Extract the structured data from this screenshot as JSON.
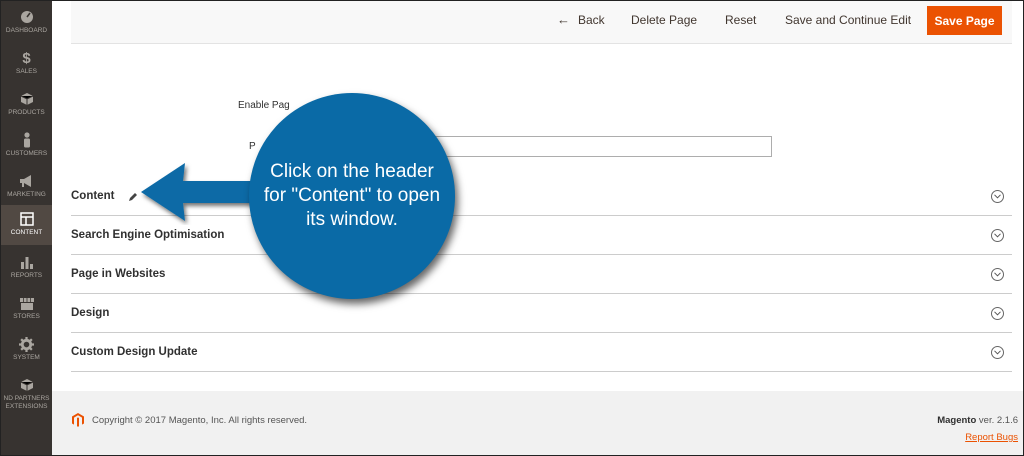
{
  "sidebar": {
    "items": [
      {
        "label": "Dashboard",
        "icon": "dashboard-icon"
      },
      {
        "label": "Sales",
        "icon": "dollar-icon"
      },
      {
        "label": "Products",
        "icon": "box-icon"
      },
      {
        "label": "Customers",
        "icon": "person-icon"
      },
      {
        "label": "Marketing",
        "icon": "megaphone-icon"
      },
      {
        "label": "Content",
        "icon": "layout-icon",
        "active": true
      },
      {
        "label": "Reports",
        "icon": "bar-chart-icon"
      },
      {
        "label": "Stores",
        "icon": "storefront-icon"
      },
      {
        "label": "System",
        "icon": "gear-icon"
      },
      {
        "label_line1": "nd Partners",
        "label_line2": "Extensions",
        "icon": "cube-icon"
      }
    ]
  },
  "toolbar": {
    "back_label": "Back",
    "delete_label": "Delete Page",
    "reset_label": "Reset",
    "save_continue_label": "Save and Continue Edit",
    "save_label": "Save Page"
  },
  "form": {
    "enable_label": "Enable Pag",
    "title_label": "P"
  },
  "sections": [
    {
      "title": "Content",
      "has_edit_icon": true
    },
    {
      "title": "Search Engine Optimisation"
    },
    {
      "title": "Page in Websites"
    },
    {
      "title": "Design"
    },
    {
      "title": "Custom Design Update"
    }
  ],
  "callout": {
    "text": "Click on the header for \"Content\" to open its window."
  },
  "footer": {
    "copyright": "Copyright © 2017 Magento, Inc. All rights reserved.",
    "brand": "Magento",
    "version": " ver. 2.1.6",
    "report_bugs": "Report Bugs"
  },
  "colors": {
    "sidebar_bg": "#373330",
    "accent": "#eb5202",
    "callout_blue": "#0a6aa6"
  }
}
